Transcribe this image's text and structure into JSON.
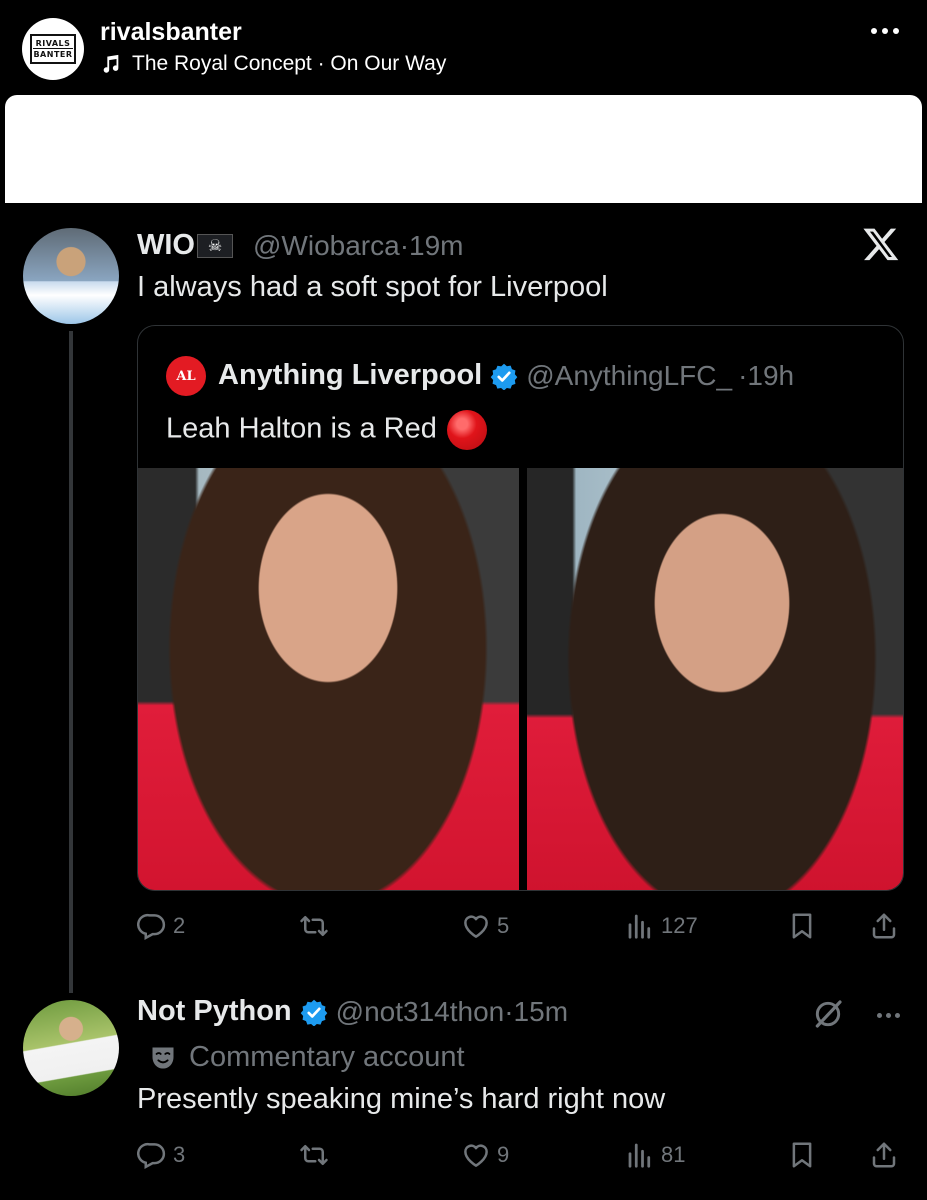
{
  "post": {
    "username": "rivalsbanter",
    "logo_text": [
      "RIVALS",
      "BANTER"
    ],
    "music": "The Royal Concept · On Our Way"
  },
  "tweet": {
    "name": "WIO",
    "flag": "☠",
    "handle": "@Wiobarca",
    "time": "·19m",
    "text": "I always had a soft spot for Liverpool"
  },
  "quote": {
    "logo_text": "AL",
    "name": "Anything Liverpool",
    "handle": "@AnythingLFC_",
    "time": "·19h",
    "text": "Leah Halton is a Red"
  },
  "tweet_actions": {
    "replies": "2",
    "likes": "5",
    "views": "127"
  },
  "reply": {
    "name": "Not Python",
    "handle": "@not314thon",
    "time": "·15m",
    "label": "Commentary account",
    "text": "Presently speaking mine’s hard right now"
  },
  "reply_actions": {
    "replies": "3",
    "likes": "9",
    "views": "81"
  },
  "colors": {
    "verified": "#1d9bf0",
    "muted": "#71767b",
    "text": "#e7e9ea",
    "liverpool_red": "#e31b23"
  }
}
